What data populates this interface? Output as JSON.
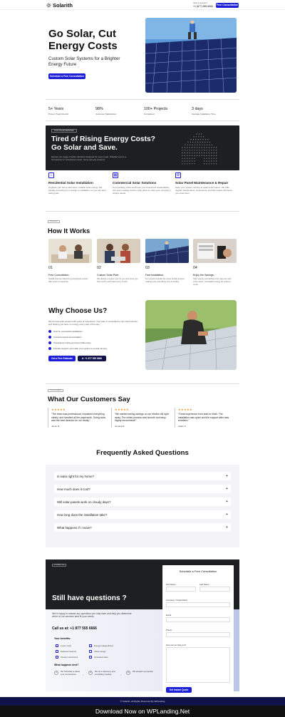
{
  "header": {
    "logo": "Solarith",
    "phone_label": "Have a question?",
    "phone": "+1 (877) 555 6666",
    "cta": "Free Consultation"
  },
  "hero": {
    "title": "Go Solar, Cut Energy Costs",
    "subtitle": "Custom Solar Systems for a Brighter Energy Future",
    "cta": "Schedule a Free Consultation"
  },
  "stats": [
    {
      "value": "5+ Years",
      "label": "Proven Track Record"
    },
    {
      "value": "98%",
      "label": "Customer Satisfaction"
    },
    {
      "value": "100+ Projects",
      "label": "Completed"
    },
    {
      "value": "3 days",
      "label": "Average Installation Time"
    }
  ],
  "band": {
    "tag": "OUR SOLAR SERVICES",
    "title": "Tired of Rising Energy Costs? Go Solar and Save.",
    "text": "Explore our range of solar solutions designed for every need. Whether you're a homeowner or a business owner, we've got you covered."
  },
  "features": [
    {
      "title": "Residential Solar Installation",
      "text": "Upgrade your home with clean, reliable solar energy. We handle everything from design to installation so you can start saving fast."
    },
    {
      "title": "Commercial Solar Solutions",
      "text": "Cut operating costs and boost your business's sustainability. Our team creates custom solar plans to meet your company's unique needs."
    },
    {
      "title": "Solar Panel Maintenance & Repair",
      "text": "Keep your system running at peak performance. We offer regular maintenance, inspections, and fast repairs whenever you need them."
    }
  ],
  "how": {
    "tag": "PROCESS",
    "title": "How It Works",
    "steps": [
      {
        "num": "01",
        "title": "Free Consultation:",
        "text": "Global chemes delivering exceptional results with years of expertise."
      },
      {
        "num": "02",
        "title": "Custom Solar Plan:",
        "text": "We design a system just for you and show you how much you'll save every month."
      },
      {
        "num": "03",
        "title": "Fast Installation:",
        "text": "Our experts handle the entire install process, making sure everything runs smoothly."
      },
      {
        "num": "04",
        "title": "Enjoy the Savings:",
        "text": "Start seeing real savings from day one with every clean, renewable energy for years to come."
      }
    ]
  },
  "why": {
    "title": "Why Choose Us?",
    "text": "We're local solar experts with years of experience. Our team is committed to top-notch service and helping you save on energy every step of the way.",
    "items": [
      "Over 5+ successful installations",
      "Licensed and insured installers",
      "Transparent pricing and zero hidden fees",
      "Friendly support, even after your system is up and running"
    ],
    "cta": "Get a Free Estimate",
    "phone": "+1 877 555 6666"
  },
  "testimonials": {
    "tag": "TESTIMONIALS",
    "title": "What Our Customers Say",
    "items": [
      {
        "stars": "★★★★★",
        "quote": "“The team was professional, explained everything clearly, and handled all the paperwork. Going solar was the best decision for our family.”",
        "author": "Jason R."
      },
      {
        "stars": "★★★★★",
        "quote": "“We started seeing savings on our electric bill right away. The whole process was smooth and easy. Highly recommend!”",
        "author": "Jessica R."
      },
      {
        "stars": "★★★★★",
        "quote": "“Great experience from start to finish. The installation was quick and the support after was excellent.”",
        "author": "Adam K."
      }
    ]
  },
  "faq": {
    "title": "Frequently Asked Questions",
    "items": [
      "Is solar right for my home?",
      "How much does it cost?",
      "Will solar panels work on cloudy days?",
      "How long does the installation take?",
      "What happens if I move?"
    ]
  },
  "contact": {
    "tag": "CONTACT US",
    "title": "Still have questions ?",
    "text": "We're happy to answer any questions you may have and help you determine which of our services best fit your needs.",
    "phone": "Call us at: +1 877 555 6666",
    "benefits_title": "Your benefits:",
    "benefits": [
      "Lower costs",
      "Energy independence",
      "Reduced footprint",
      "Clean energy",
      "Smarter investment",
      "Increased value"
    ],
    "next_title": "What happens next?",
    "next": [
      {
        "num": "1",
        "text": "We Schedule a call at your convenience"
      },
      {
        "num": "2",
        "text": "We do a discovery and consulting meeting"
      },
      {
        "num": "3",
        "text": "We prepare a proposal"
      }
    ]
  },
  "form": {
    "title": "Schedule a Free Consultation",
    "first_name": "First Name",
    "last_name": "Last Name",
    "company": "Company / Organization",
    "email": "Email",
    "phone": "Phone",
    "help": "How can we help you?",
    "submit": "Get Instant Quote"
  },
  "footer": {
    "text": "© Solarith. All Rights Reserved By WPlanding",
    "download": "Download Now on WPLanding.Net"
  },
  "colors": {
    "accent": "#1d1fd6",
    "dark": "#1e1f22",
    "navy": "#12124a",
    "star": "#f08a1c"
  }
}
